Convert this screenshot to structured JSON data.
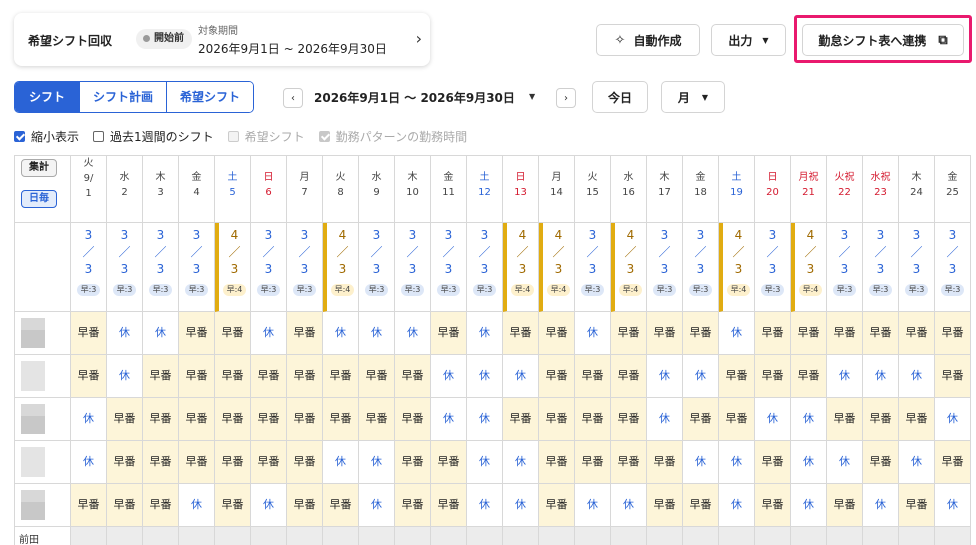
{
  "collect_card": {
    "title": "希望シフト回収",
    "status": "開始前",
    "period_label": "対象期間",
    "period_value": "2026年9月1日 ~ 2026年9月30日"
  },
  "toolbar": {
    "auto_create": "自動作成",
    "export": "出力",
    "link_attendance": "勤怠シフト表へ連携"
  },
  "view_tabs": [
    "シフト",
    "シフト計画",
    "希望シフト"
  ],
  "date_range": "2026年9月1日 〜 2026年9月30日",
  "today_button": "今日",
  "period_select": "月",
  "checkboxes": [
    {
      "label": "縮小表示",
      "checked": true,
      "disabled": false
    },
    {
      "label": "過去1週間のシフト",
      "checked": false,
      "disabled": false
    },
    {
      "label": "希望シフト",
      "checked": false,
      "disabled": true
    },
    {
      "label": "勤務パターンの勤務時間",
      "checked": true,
      "disabled": true
    }
  ],
  "grid": {
    "total_label": "集計",
    "daily_label": "日毎",
    "days": [
      {
        "wd": "火",
        "d": "9/\n1",
        "type": "weekday",
        "need": "3",
        "have": "3",
        "tag": "早:3",
        "warm": false
      },
      {
        "wd": "水",
        "d": "2",
        "type": "weekday",
        "need": "3",
        "have": "3",
        "tag": "早:3",
        "warm": false
      },
      {
        "wd": "木",
        "d": "3",
        "type": "weekday",
        "need": "3",
        "have": "3",
        "tag": "早:3",
        "warm": false
      },
      {
        "wd": "金",
        "d": "4",
        "type": "weekday",
        "need": "3",
        "have": "3",
        "tag": "早:3",
        "warm": false
      },
      {
        "wd": "土",
        "d": "5",
        "type": "sat",
        "need": "4",
        "have": "3",
        "tag": "早:4",
        "warm": true
      },
      {
        "wd": "日",
        "d": "6",
        "type": "sun",
        "need": "3",
        "have": "3",
        "tag": "早:3",
        "warm": false
      },
      {
        "wd": "月",
        "d": "7",
        "type": "weekday",
        "need": "3",
        "have": "3",
        "tag": "早:3",
        "warm": false
      },
      {
        "wd": "火",
        "d": "8",
        "type": "weekday",
        "need": "4",
        "have": "3",
        "tag": "早:4",
        "warm": true
      },
      {
        "wd": "水",
        "d": "9",
        "type": "weekday",
        "need": "3",
        "have": "3",
        "tag": "早:3",
        "warm": false
      },
      {
        "wd": "木",
        "d": "10",
        "type": "weekday",
        "need": "3",
        "have": "3",
        "tag": "早:3",
        "warm": false
      },
      {
        "wd": "金",
        "d": "11",
        "type": "weekday",
        "need": "3",
        "have": "3",
        "tag": "早:3",
        "warm": false
      },
      {
        "wd": "土",
        "d": "12",
        "type": "sat",
        "need": "3",
        "have": "3",
        "tag": "早:3",
        "warm": false
      },
      {
        "wd": "日",
        "d": "13",
        "type": "sun",
        "need": "4",
        "have": "3",
        "tag": "早:4",
        "warm": true
      },
      {
        "wd": "月",
        "d": "14",
        "type": "weekday",
        "need": "4",
        "have": "3",
        "tag": "早:4",
        "warm": true
      },
      {
        "wd": "火",
        "d": "15",
        "type": "weekday",
        "need": "3",
        "have": "3",
        "tag": "早:3",
        "warm": false
      },
      {
        "wd": "水",
        "d": "16",
        "type": "weekday",
        "need": "4",
        "have": "3",
        "tag": "早:4",
        "warm": true
      },
      {
        "wd": "木",
        "d": "17",
        "type": "weekday",
        "need": "3",
        "have": "3",
        "tag": "早:3",
        "warm": false
      },
      {
        "wd": "金",
        "d": "18",
        "type": "weekday",
        "need": "3",
        "have": "3",
        "tag": "早:3",
        "warm": false
      },
      {
        "wd": "土",
        "d": "19",
        "type": "sat",
        "need": "4",
        "have": "3",
        "tag": "早:4",
        "warm": true
      },
      {
        "wd": "日",
        "d": "20",
        "type": "sun",
        "need": "3",
        "have": "3",
        "tag": "早:3",
        "warm": false
      },
      {
        "wd": "月祝",
        "d": "21",
        "type": "sun",
        "need": "4",
        "have": "3",
        "tag": "早:4",
        "warm": true
      },
      {
        "wd": "火祝",
        "d": "22",
        "type": "sun",
        "need": "3",
        "have": "3",
        "tag": "早:3",
        "warm": false
      },
      {
        "wd": "水祝",
        "d": "23",
        "type": "sun",
        "need": "3",
        "have": "3",
        "tag": "早:3",
        "warm": false
      },
      {
        "wd": "木",
        "d": "24",
        "type": "weekday",
        "need": "3",
        "have": "3",
        "tag": "早:3",
        "warm": false
      },
      {
        "wd": "金",
        "d": "25",
        "type": "weekday",
        "need": "3",
        "have": "3",
        "tag": "早:3",
        "warm": false
      }
    ],
    "shift_labels": {
      "early": "早番",
      "off": "休"
    },
    "rows": [
      [
        "early",
        "off",
        "off",
        "early",
        "early",
        "off",
        "early",
        "off",
        "off",
        "off",
        "early",
        "off",
        "early",
        "early",
        "off",
        "early",
        "early",
        "early",
        "off",
        "early",
        "early",
        "early",
        "early",
        "early",
        "early"
      ],
      [
        "early",
        "off",
        "early",
        "early",
        "early",
        "early",
        "early",
        "early",
        "early",
        "early",
        "off",
        "off",
        "off",
        "early",
        "early",
        "early",
        "off",
        "off",
        "early",
        "early",
        "early",
        "off",
        "off",
        "off",
        "early"
      ],
      [
        "off",
        "early",
        "early",
        "early",
        "early",
        "early",
        "early",
        "early",
        "early",
        "early",
        "off",
        "off",
        "early",
        "early",
        "early",
        "early",
        "off",
        "early",
        "early",
        "off",
        "off",
        "early",
        "early",
        "early",
        "off"
      ],
      [
        "off",
        "early",
        "early",
        "early",
        "early",
        "early",
        "early",
        "off",
        "off",
        "early",
        "early",
        "off",
        "off",
        "early",
        "early",
        "early",
        "early",
        "off",
        "off",
        "early",
        "off",
        "off",
        "early",
        "off",
        "early"
      ],
      [
        "early",
        "early",
        "early",
        "off",
        "early",
        "off",
        "early",
        "early",
        "off",
        "early",
        "early",
        "off",
        "off",
        "early",
        "off",
        "off",
        "early",
        "early",
        "off",
        "early",
        "off",
        "early",
        "off",
        "early",
        "off"
      ]
    ],
    "last_row_name": "前田"
  }
}
